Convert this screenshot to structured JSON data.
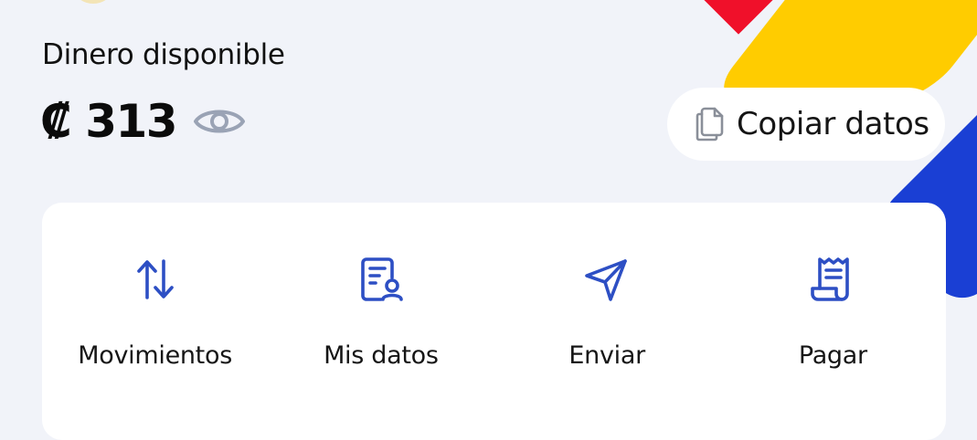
{
  "colors": {
    "background": "#f1f3f9",
    "card": "#ffffff",
    "icon_blue": "#2d4fc4",
    "eye_gray": "#9aa3b5",
    "accent_yellow": "#ffcc00",
    "accent_red": "#f0102a",
    "accent_blue": "#1a3fd4"
  },
  "balance": {
    "label": "Dinero disponible",
    "amount": "₡ 313",
    "visibility_icon": "eye-icon"
  },
  "copy": {
    "label": "Copiar datos",
    "icon": "copy-document-icon"
  },
  "actions": [
    {
      "label": "Movimientos",
      "icon": "arrows-up-down-icon"
    },
    {
      "label": "Mis datos",
      "icon": "user-document-icon"
    },
    {
      "label": "Enviar",
      "icon": "send-icon"
    },
    {
      "label": "Pagar",
      "icon": "receipt-icon"
    }
  ]
}
